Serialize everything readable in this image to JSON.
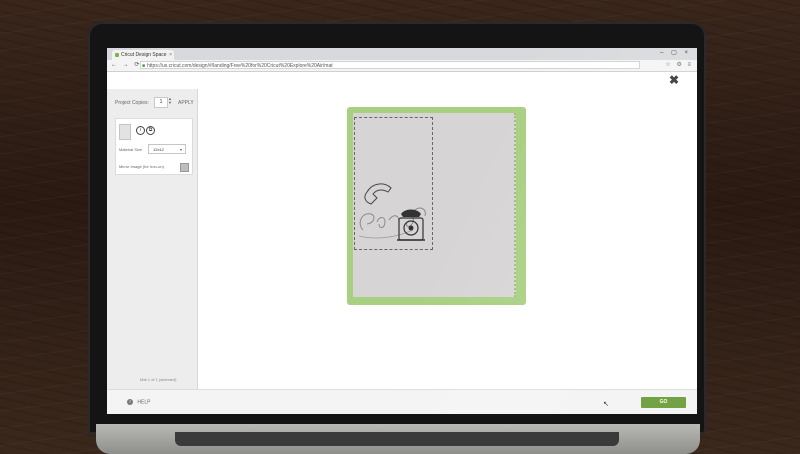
{
  "browser": {
    "tab_title": "Cricut Design Space",
    "tab_close": "×",
    "window_controls": "– ▢ ×",
    "nav_buttons": "← → ⟳ ⌂",
    "url": "https://us.cricut.com/design/#/landing/Free%20for%20Cricut%20Explore%20Air/mat",
    "extension_icons": "☆ ⚙ ≡"
  },
  "app": {
    "close_label": "✖"
  },
  "left_panel": {
    "project_copies_label": "Project Copies:",
    "project_copies_value": "1",
    "apply_label": "APPLY",
    "material_size_label": "Material Size",
    "material_size_value": "12x12",
    "mirror_label": "Mirror Image (for Iron-on)",
    "page_info": "Mat 1 of 1 (selected)",
    "icons": [
      "document-icon",
      "info-icon",
      "copy-icon"
    ]
  },
  "footer": {
    "help_label": "HELP",
    "go_label": "GO"
  },
  "colors": {
    "mat_green": "#a9cf81",
    "go_button": "#72a244"
  }
}
